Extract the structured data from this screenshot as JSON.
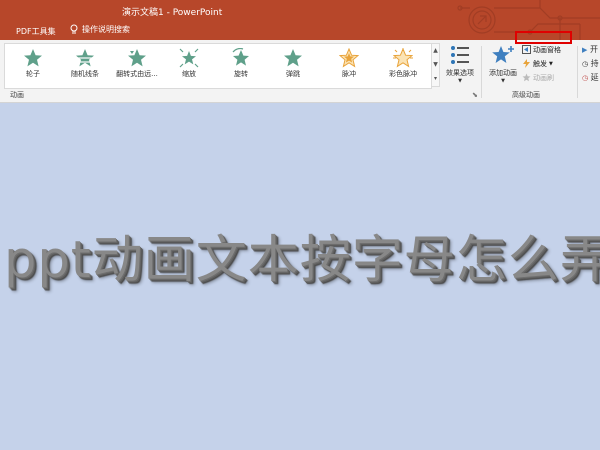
{
  "window": {
    "title": "演示文稿1  -  PowerPoint"
  },
  "menu": {
    "pdf_tools": "PDF工具集",
    "tell_me": "操作说明搜索"
  },
  "animations": {
    "items": [
      {
        "label": "轮子",
        "icon": "star-wheel-icon"
      },
      {
        "label": "随机线条",
        "icon": "star-random-bars-icon"
      },
      {
        "label": "翻转式由远...",
        "icon": "star-flip-icon"
      },
      {
        "label": "缩放",
        "icon": "star-zoom-icon"
      },
      {
        "label": "旋转",
        "icon": "star-spin-icon"
      },
      {
        "label": "弹跳",
        "icon": "star-bounce-icon"
      },
      {
        "label": "脉冲",
        "icon": "star-pulse-icon"
      },
      {
        "label": "彩色脉冲",
        "icon": "star-color-pulse-icon"
      }
    ],
    "effect_options": "效果选项",
    "group_label": "动画"
  },
  "advanced": {
    "add_animation": "添加动画",
    "animation_pane": "动画窗格",
    "trigger": "触发",
    "animation_painter": "动画刷",
    "group_label": "高级动画"
  },
  "timing": {
    "items": [
      "开",
      "持",
      "延"
    ]
  },
  "slide": {
    "text": "ppt动画文本按字母怎么弄"
  },
  "colors": {
    "accent": "#b7472a",
    "star_green": "#5fa08a",
    "star_gold": "#e8a33a",
    "highlight": "#e00000",
    "slide_bg": "#c5d2ea"
  }
}
